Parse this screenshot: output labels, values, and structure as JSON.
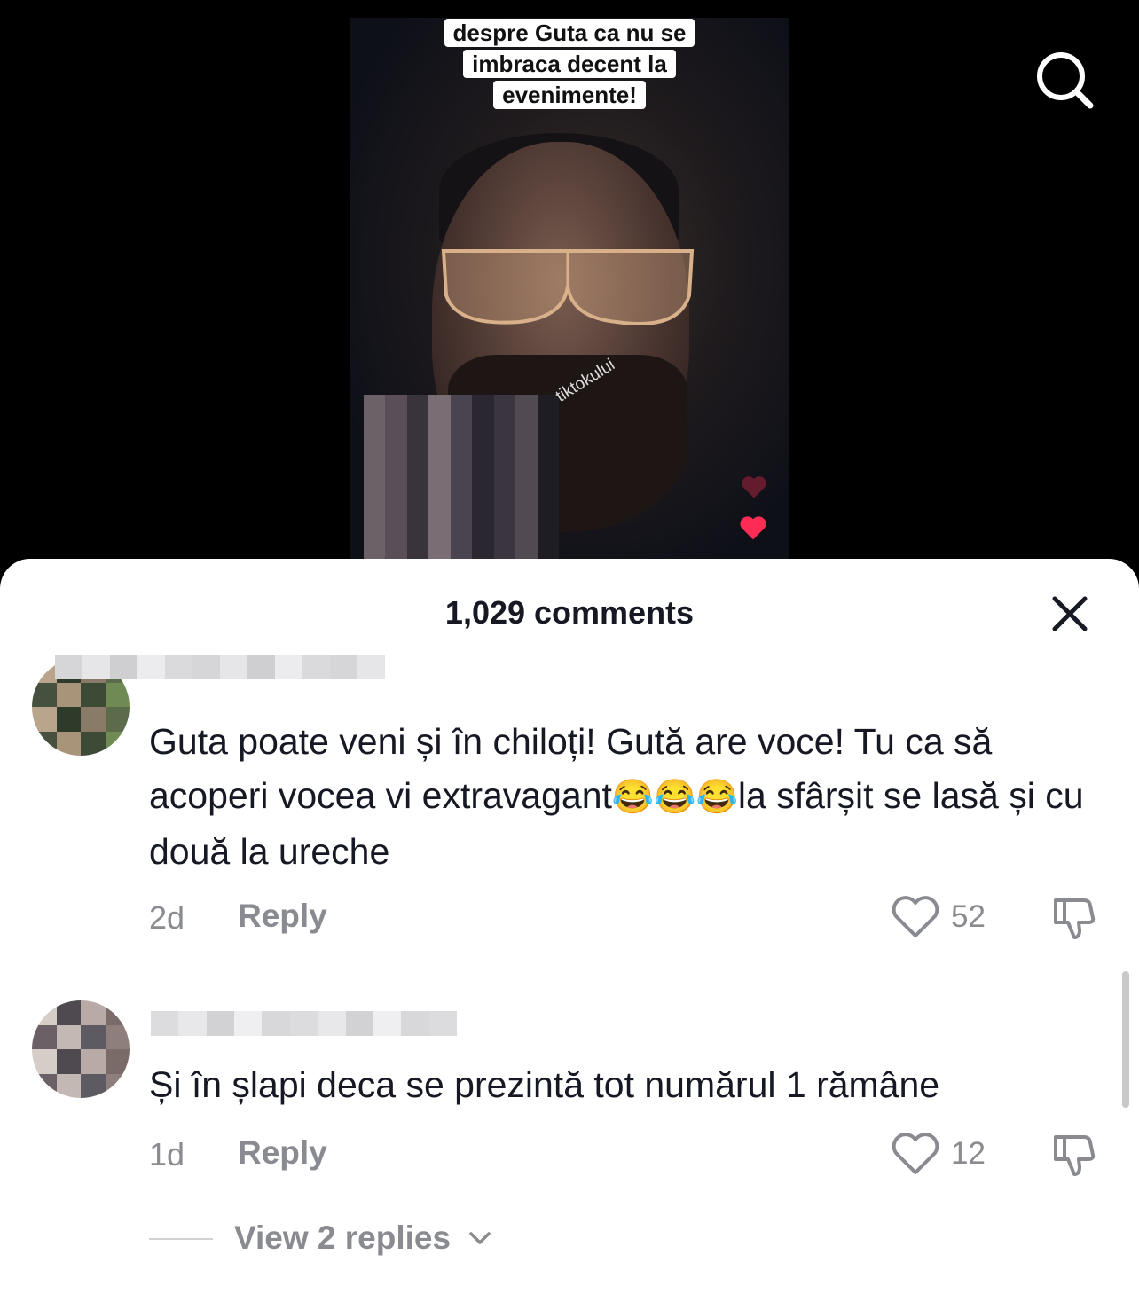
{
  "video": {
    "caption_lines": [
      "despre Guta ca nu se",
      "imbraca decent la",
      "evenimente!"
    ],
    "watermark": "tiktokului"
  },
  "comments_sheet": {
    "title": "1,029 comments",
    "comments": [
      {
        "text_before_emoji": "Guta poate veni și în chiloți! Gută are voce! Tu ca să acoperi vocea vi extravagant",
        "emojis": "😂😂😂",
        "text_after_emoji": "la sfârșit se lasă și cu două la ureche",
        "time": "2d",
        "reply_label": "Reply",
        "likes": "52"
      },
      {
        "text": "Și în șlapi deca se prezintă tot numărul 1 rămâne",
        "time": "1d",
        "reply_label": "Reply",
        "likes": "12",
        "view_replies_label": "View 2 replies"
      }
    ]
  },
  "colors": {
    "like_heart": "#fe2c55",
    "meta_gray": "#8a8b91",
    "text_dark": "#161823"
  },
  "icons": [
    "search-icon",
    "close-icon",
    "heart-outline-icon",
    "dislike-icon",
    "chevron-down-icon"
  ]
}
